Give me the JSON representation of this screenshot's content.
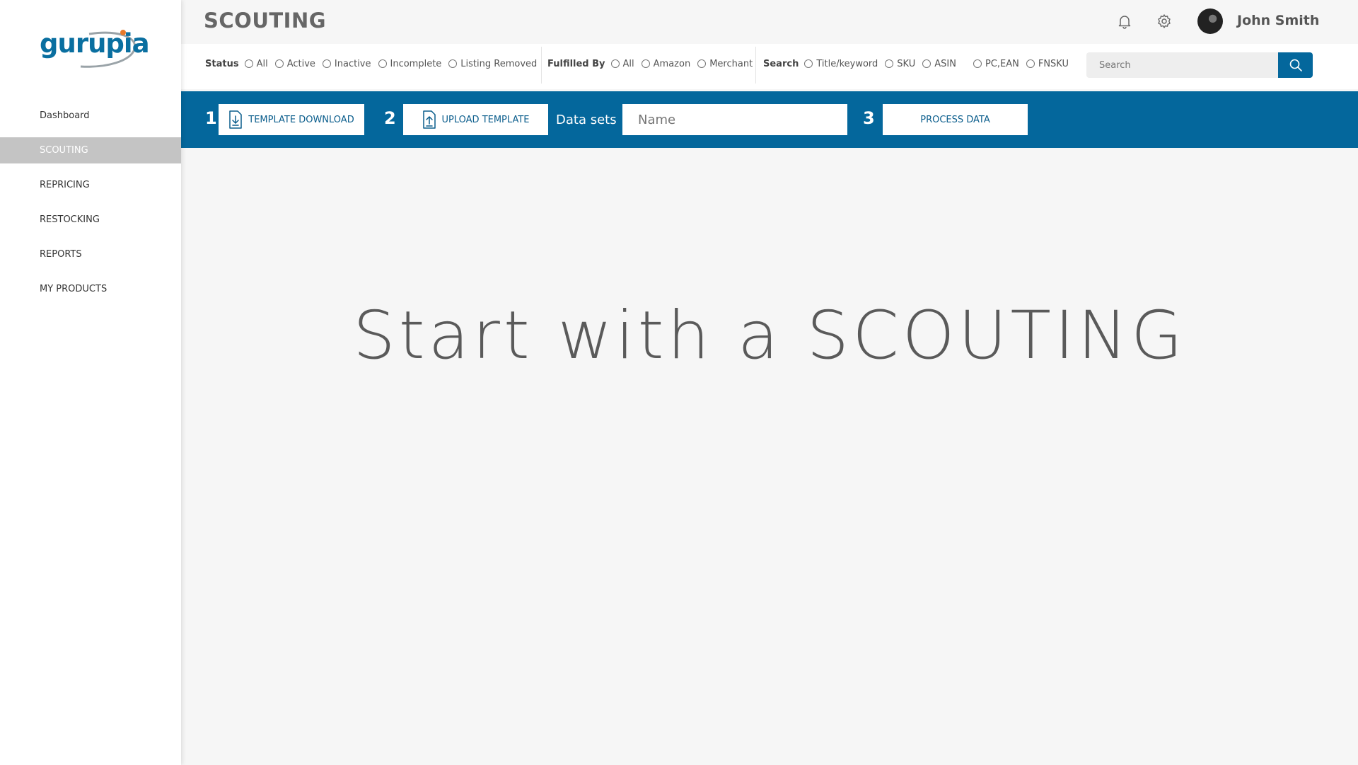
{
  "app": {
    "brand": "gurupia"
  },
  "sidebar": {
    "items": [
      {
        "label": "Dashboard"
      },
      {
        "label": "SCOUTING"
      },
      {
        "label": "REPRICING"
      },
      {
        "label": "RESTOCKING"
      },
      {
        "label": "REPORTS"
      },
      {
        "label": "MY PRODUCTS"
      }
    ],
    "active_index": 1
  },
  "header": {
    "title": "SCOUTING",
    "user_name": "John Smith",
    "icons": [
      "bell-icon",
      "gear-icon"
    ]
  },
  "filters": {
    "status": {
      "label": "Status",
      "options": [
        "All",
        "Active",
        "Inactive",
        "Incomplete",
        "Listing Removed"
      ]
    },
    "fulfilled_by": {
      "label": "Fulfilled By",
      "options": [
        "All",
        "Amazon",
        "Merchant"
      ]
    },
    "search_by": {
      "label": "Search",
      "options": [
        "Title/keyword",
        "SKU",
        "ASIN",
        "PC,EAN",
        "FNSKU"
      ]
    },
    "search_placeholder": "Search"
  },
  "toolbar": {
    "step1": "1",
    "template_download": "TEMPLATE DOWNLOAD",
    "step2": "2",
    "upload_template": "UPLOAD TEMPLATE",
    "datasets_label": "Data sets",
    "name_placeholder": "Name",
    "step3": "3",
    "process_data": "PROCESS DATA"
  },
  "main": {
    "hero_text": "Start with a SCOUTING"
  },
  "colors": {
    "accent": "#04679c",
    "brand": "#0a6fa0",
    "brand_orange": "#e8792a",
    "sidebar_active": "#c4c4c4"
  }
}
